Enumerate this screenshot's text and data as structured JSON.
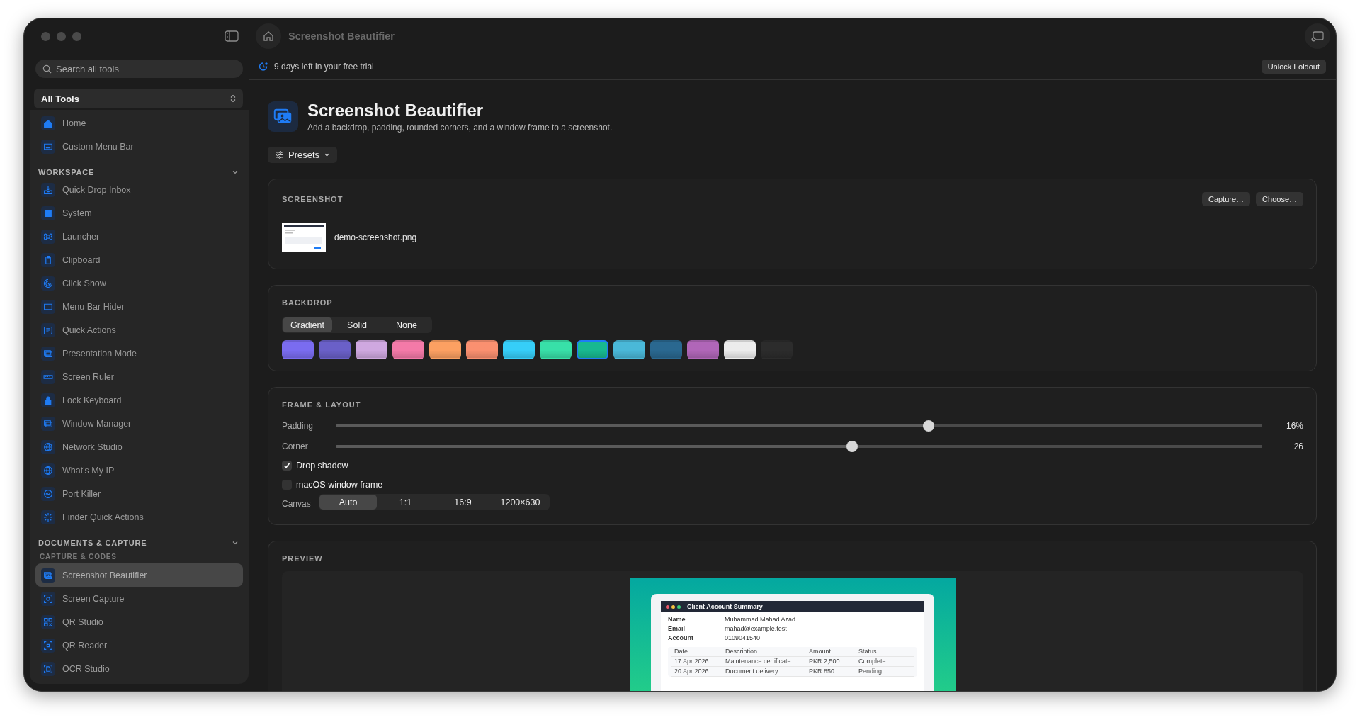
{
  "window": {
    "title": "Screenshot Beautifier"
  },
  "sidebar": {
    "search": {
      "placeholder": "Search all tools"
    },
    "filter": "All Tools",
    "items": [
      {
        "label": "Home",
        "selected": false
      },
      {
        "label": "Custom Menu Bar",
        "selected": false
      }
    ],
    "sections": [
      {
        "title": "WORKSPACE",
        "expanded": true,
        "items": [
          {
            "label": "Quick Drop Inbox",
            "selected": false
          },
          {
            "label": "System",
            "selected": false
          },
          {
            "label": "Launcher",
            "selected": false
          },
          {
            "label": "Clipboard",
            "selected": false
          },
          {
            "label": "Click Show",
            "selected": false
          },
          {
            "label": "Menu Bar Hider",
            "selected": false
          },
          {
            "label": "Quick Actions",
            "selected": false
          },
          {
            "label": "Presentation Mode",
            "selected": false
          },
          {
            "label": "Screen Ruler",
            "selected": false
          },
          {
            "label": "Lock Keyboard",
            "selected": false
          },
          {
            "label": "Window Manager",
            "selected": false
          },
          {
            "label": "Network Studio",
            "selected": false
          },
          {
            "label": "What's My IP",
            "selected": false
          },
          {
            "label": "Port Killer",
            "selected": false
          },
          {
            "label": "Finder Quick Actions",
            "selected": false
          }
        ]
      },
      {
        "title": "DOCUMENTS & CAPTURE",
        "expanded": true,
        "subtitle": "CAPTURE & CODES",
        "items": [
          {
            "label": "Screenshot Beautifier",
            "selected": true
          },
          {
            "label": "Screen Capture",
            "selected": false
          },
          {
            "label": "QR Studio",
            "selected": false
          },
          {
            "label": "QR Reader",
            "selected": false
          },
          {
            "label": "OCR Studio",
            "selected": false
          }
        ]
      }
    ]
  },
  "trial_banner": {
    "text": "9 days left in your free trial",
    "button": "Unlock Foldout"
  },
  "header": {
    "title": "Screenshot Beautifier",
    "subtitle": "Add a backdrop, padding, rounded corners, and a window frame to a screenshot."
  },
  "presets_button": "Presets",
  "screenshot_card": {
    "title": "SCREENSHOT",
    "buttons": [
      "Capture…",
      "Choose…"
    ],
    "file_name": "demo-screenshot.png"
  },
  "backdrop": {
    "title": "BACKDROP",
    "modes": [
      {
        "label": "Gradient",
        "selected": true
      },
      {
        "label": "Solid",
        "selected": false
      },
      {
        "label": "None",
        "selected": false
      }
    ],
    "swatches": [
      {
        "color": "#7a6cf0",
        "selected": false
      },
      {
        "color": "#6a60c8",
        "selected": false
      },
      {
        "color": "#cfa8e0",
        "selected": false
      },
      {
        "color": "#f47aa8",
        "selected": false
      },
      {
        "color": "#fca062",
        "selected": false
      },
      {
        "color": "#fa9070",
        "selected": false
      },
      {
        "color": "#36cef8",
        "selected": false
      },
      {
        "color": "#38e0a8",
        "selected": false
      },
      {
        "color": "#18b890",
        "selected": true
      },
      {
        "color": "#4ab8d8",
        "selected": false
      },
      {
        "color": "#2a6890",
        "selected": false
      },
      {
        "color": "#b066b8",
        "selected": false
      },
      {
        "color": "#ececec",
        "selected": false
      },
      {
        "color": "#2c2c2c",
        "selected": false
      }
    ]
  },
  "frame_layout": {
    "title": "FRAME & LAYOUT",
    "sliders": [
      {
        "label": "Padding",
        "level": 0.64,
        "reading": "16%"
      },
      {
        "label": "Corner",
        "level": 0.557,
        "reading": "26"
      }
    ],
    "checkboxes": [
      {
        "label": "Drop shadow",
        "checked": true
      },
      {
        "label": "macOS window frame",
        "checked": false
      }
    ],
    "canvas": {
      "label": "Canvas",
      "options": [
        {
          "label": "Auto",
          "selected": true
        },
        {
          "label": "1:1",
          "selected": false
        },
        {
          "label": "16:9",
          "selected": false
        },
        {
          "label": "1200×630",
          "selected": false
        }
      ]
    }
  },
  "preview": {
    "title": "PREVIEW",
    "document": {
      "title": "Client Account Summary",
      "fields": [
        {
          "label": "Name",
          "value": "Muhammad Mahad Azad"
        },
        {
          "label": "Email",
          "value": "mahad@example.test"
        },
        {
          "label": "Account",
          "value": "0109041540"
        }
      ],
      "columns": [
        "Date",
        "Description",
        "Amount",
        "Status"
      ],
      "rows": [
        [
          "17 Apr 2026",
          "Maintenance certificate",
          "PKR 2,500",
          "Complete"
        ],
        [
          "20 Apr 2026",
          "Document delivery",
          "PKR 850",
          "Pending"
        ]
      ]
    }
  }
}
